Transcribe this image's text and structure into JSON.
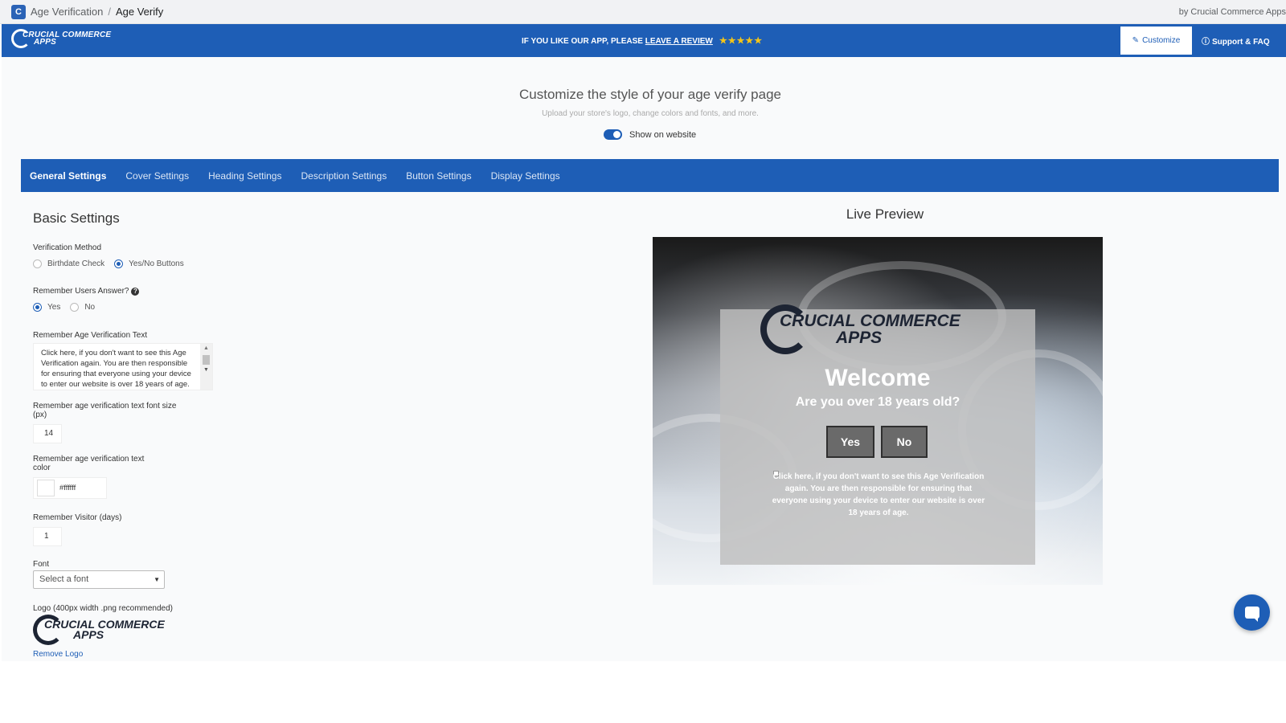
{
  "breadcrumb": {
    "parent": "Age Verification",
    "separator": "/",
    "current": "Age Verify"
  },
  "byline": "by Crucial Commerce Apps",
  "header": {
    "brand_line1": "CRUCIAL COMMERCE",
    "brand_line2": "APPS",
    "review_prefix": "IF YOU LIKE OUR APP, PLEASE ",
    "review_link": "LEAVE A REVIEW",
    "stars": "★★★★★",
    "customize_label": "Customize",
    "support_label": "Support & FAQ"
  },
  "page": {
    "title": "Customize the style of your age verify page",
    "subtitle": "Upload your store's logo, change colors and fonts, and more.",
    "toggle_label": "Show on website",
    "show_on_website": true
  },
  "tabs": [
    {
      "label": "General Settings",
      "active": true
    },
    {
      "label": "Cover Settings",
      "active": false
    },
    {
      "label": "Heading Settings",
      "active": false
    },
    {
      "label": "Description Settings",
      "active": false
    },
    {
      "label": "Button Settings",
      "active": false
    },
    {
      "label": "Display Settings",
      "active": false
    }
  ],
  "basic_settings": {
    "title": "Basic Settings",
    "verification_method": {
      "label": "Verification Method",
      "options": [
        "Birthdate Check",
        "Yes/No Buttons"
      ],
      "selected": "Yes/No Buttons"
    },
    "remember_answer": {
      "label": "Remember Users Answer?",
      "options": [
        "Yes",
        "No"
      ],
      "selected": "Yes"
    },
    "remember_text": {
      "label": "Remember Age Verification Text",
      "value": "Click here, if you don't want to see this Age Verification again. You are then responsible for ensuring that everyone using your device to enter our website is over 18 years of age."
    },
    "font_size": {
      "label": "Remember age verification text font size (px)",
      "value": "14"
    },
    "text_color": {
      "label": "Remember age verification text color",
      "value": "#ffffff"
    },
    "remember_days": {
      "label": "Remember Visitor (days)",
      "value": "1"
    },
    "font": {
      "label": "Font",
      "placeholder": "Select a font"
    },
    "logo": {
      "label": "Logo (400px width .png recommended)",
      "remove_label": "Remove Logo",
      "line1": "CRUCIAL COMMERCE",
      "line2": "APPS"
    }
  },
  "preview": {
    "title": "Live Preview",
    "logo_line1": "CRUCIAL COMMERCE",
    "logo_line2": "APPS",
    "welcome": "Welcome",
    "question": "Are you over 18 years old?",
    "yes_label": "Yes",
    "no_label": "No",
    "remember_text": "Click here, if you don't want to see this Age Verification again. You are then responsible for ensuring that everyone using your device to enter our website is over 18 years of age."
  },
  "colors": {
    "brand_blue": "#1e5eb6",
    "star": "#f5c518",
    "logo_navy": "#1d2433"
  },
  "icons": [
    "app-icon",
    "edit-icon",
    "help-circle-icon",
    "star-icon",
    "question-icon",
    "chat-icon",
    "chevron-down-icon"
  ]
}
